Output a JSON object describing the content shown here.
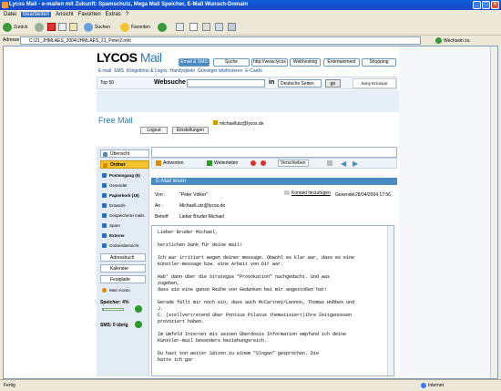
{
  "window": {
    "title": "Lycos Mail - e-mailen mit Zukunft: Spamschutz, Mega Mail Speicher, E-Mail Wunsch-Domain"
  },
  "menu": [
    "Datei",
    "Bearbeiten",
    "Ansicht",
    "Favoriten",
    "Extras",
    "?"
  ],
  "menu_active": 1,
  "toolbar": {
    "back": "Zurück",
    "search": "Suchen",
    "favorites": "Favoriten"
  },
  "address": {
    "label": "Adresse",
    "value": "C:\\21_JHMLAES_2004\\JHMLAES_21_Peter2.mht",
    "go": "Wechseln zu"
  },
  "site": {
    "logo_main": "LYCOS",
    "logo_sub": "Mail",
    "tabs": [
      "Email & SMS",
      "Suche",
      "http://www.lycos",
      "Webhosting",
      "Entertainment",
      "Shopping"
    ],
    "subnav": [
      "E-mail",
      "SMS",
      "Klingeltöne & Logos",
      "Handyspiele",
      "Günstiger telefonieren",
      "E-Cards"
    ],
    "top50": "Top 50",
    "websuche": "Websuche",
    "in": "in",
    "search_scope": "Deutsche Seiten",
    "search_go": "go",
    "sponsor": "Sony Ericsson"
  },
  "freemail": {
    "title": "Free Mail",
    "logout": "Logout",
    "settings": "Einstellungen",
    "user": "michaellutz@lycos.de"
  },
  "nav": {
    "overview": "Übersicht",
    "folders_label": "Ordner",
    "folders": [
      "Posteingang (5)",
      "Gesendet",
      "Papierkorb (19)",
      "Entwürfe",
      "Gespeicherte mails",
      "Spam",
      "Externe",
      "Ordnerübersicht"
    ],
    "addressbook": "Adressbuch",
    "calendar": "Kalender",
    "harddisk": "Festplatte",
    "account": "Mein Konto",
    "storage_label": "Speicher: 4%",
    "sms_label": "SMS: 0 übrig"
  },
  "actions": {
    "reply": "Antworten",
    "forward": "Weiterleiten",
    "move": "Verschieben"
  },
  "mail": {
    "section_title": "E-Mail lesen",
    "from_label": "Von :",
    "from_value": "\"Peter Völker\"",
    "add_contact": "Kontakt hinzufügen",
    "sent_label": "Gesendet",
    "sent_value": "28/04/2004 17:56",
    "to_label": "An :",
    "to_value": "MichaelLutz@lycos.de",
    "subject_label": "Betreff",
    "subject_value": "Lieber Bruder Michael",
    "body": [
      "Lieber Bruder Michael,",
      "herzlichen Dank für deine mail!",
      "Ich war irritiert wegen deiner message. Obwohl es klar war, dass es eine\nKünstler-message bzw. eine Arbeit von Dir war.",
      "Hab' dann über die Strategie \"Provokation\" nachgedacht. Und was\nzugeben,\ndass sie eine ganze Reihe von Gedanken bei mir angestoßen hat!",
      "Gerade fällt mir noch ein, dass auch McCartney/Lennon, Thomas Hobbes und\nJ.\nC. (stellvertretend über Pontius Pilatus thematisiert)ihre Zeitgenossen\nprovoziert haben.",
      "Im Umfeld Internet mit seinen Überdosis Information empfand ich deine\nKünstler-mail besonders beziehungsreich.",
      "Du hast von weiter Sätzen zu einem \"Slogan\" gesprochen. Die\nbatte ich gar"
    ]
  },
  "status": {
    "left": "Fertig",
    "zone": "Internet"
  }
}
